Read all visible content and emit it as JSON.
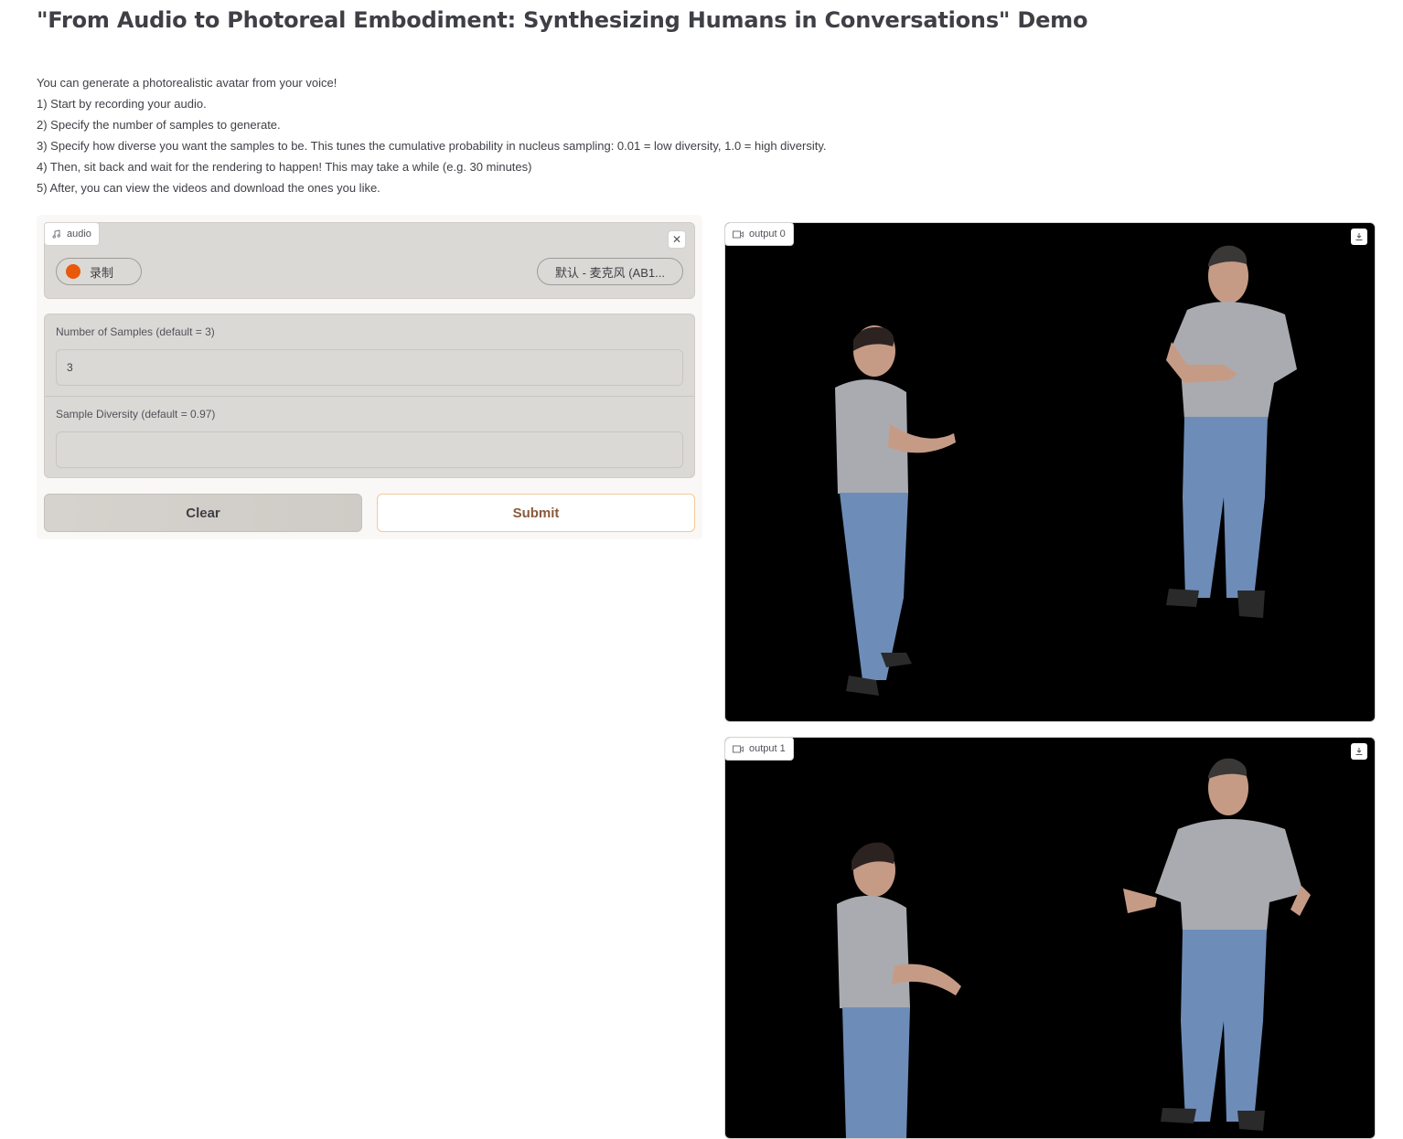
{
  "page": {
    "title": "\"From Audio to Photoreal Embodiment: Synthesizing Humans in Conversations\" Demo",
    "intro": [
      "You can generate a photorealistic avatar from your voice!",
      "1) Start by recording your audio.",
      "2) Specify the number of samples to generate.",
      "3) Specify how diverse you want the samples to be. This tunes the cumulative probability in nucleus sampling: 0.01 = low diversity, 1.0 = high diversity.",
      "4) Then, sit back and wait for the rendering to happen! This may take a while (e.g. 30 minutes)",
      "5) After, you can view the videos and download the ones you like."
    ]
  },
  "audio": {
    "label": "audio",
    "icon": "music-note-icon",
    "record_label": "录制",
    "mic_select": "默认 - 麦克风 (AB1...",
    "clear_icon": "close-icon"
  },
  "form": {
    "samples_label": "Number of Samples (default = 3)",
    "samples_value": "3",
    "diversity_label": "Sample Diversity (default = 0.97)",
    "diversity_value": ""
  },
  "buttons": {
    "clear": "Clear",
    "submit": "Submit"
  },
  "outputs": [
    {
      "label": "output 0",
      "icon": "video-icon",
      "download_icon": "download-icon"
    },
    {
      "label": "output 1",
      "icon": "video-icon",
      "download_icon": "download-icon"
    }
  ],
  "colors": {
    "record_dot": "#e8590c",
    "submit_border": "#f3c995",
    "panel_bg": "#dbd9d5"
  }
}
